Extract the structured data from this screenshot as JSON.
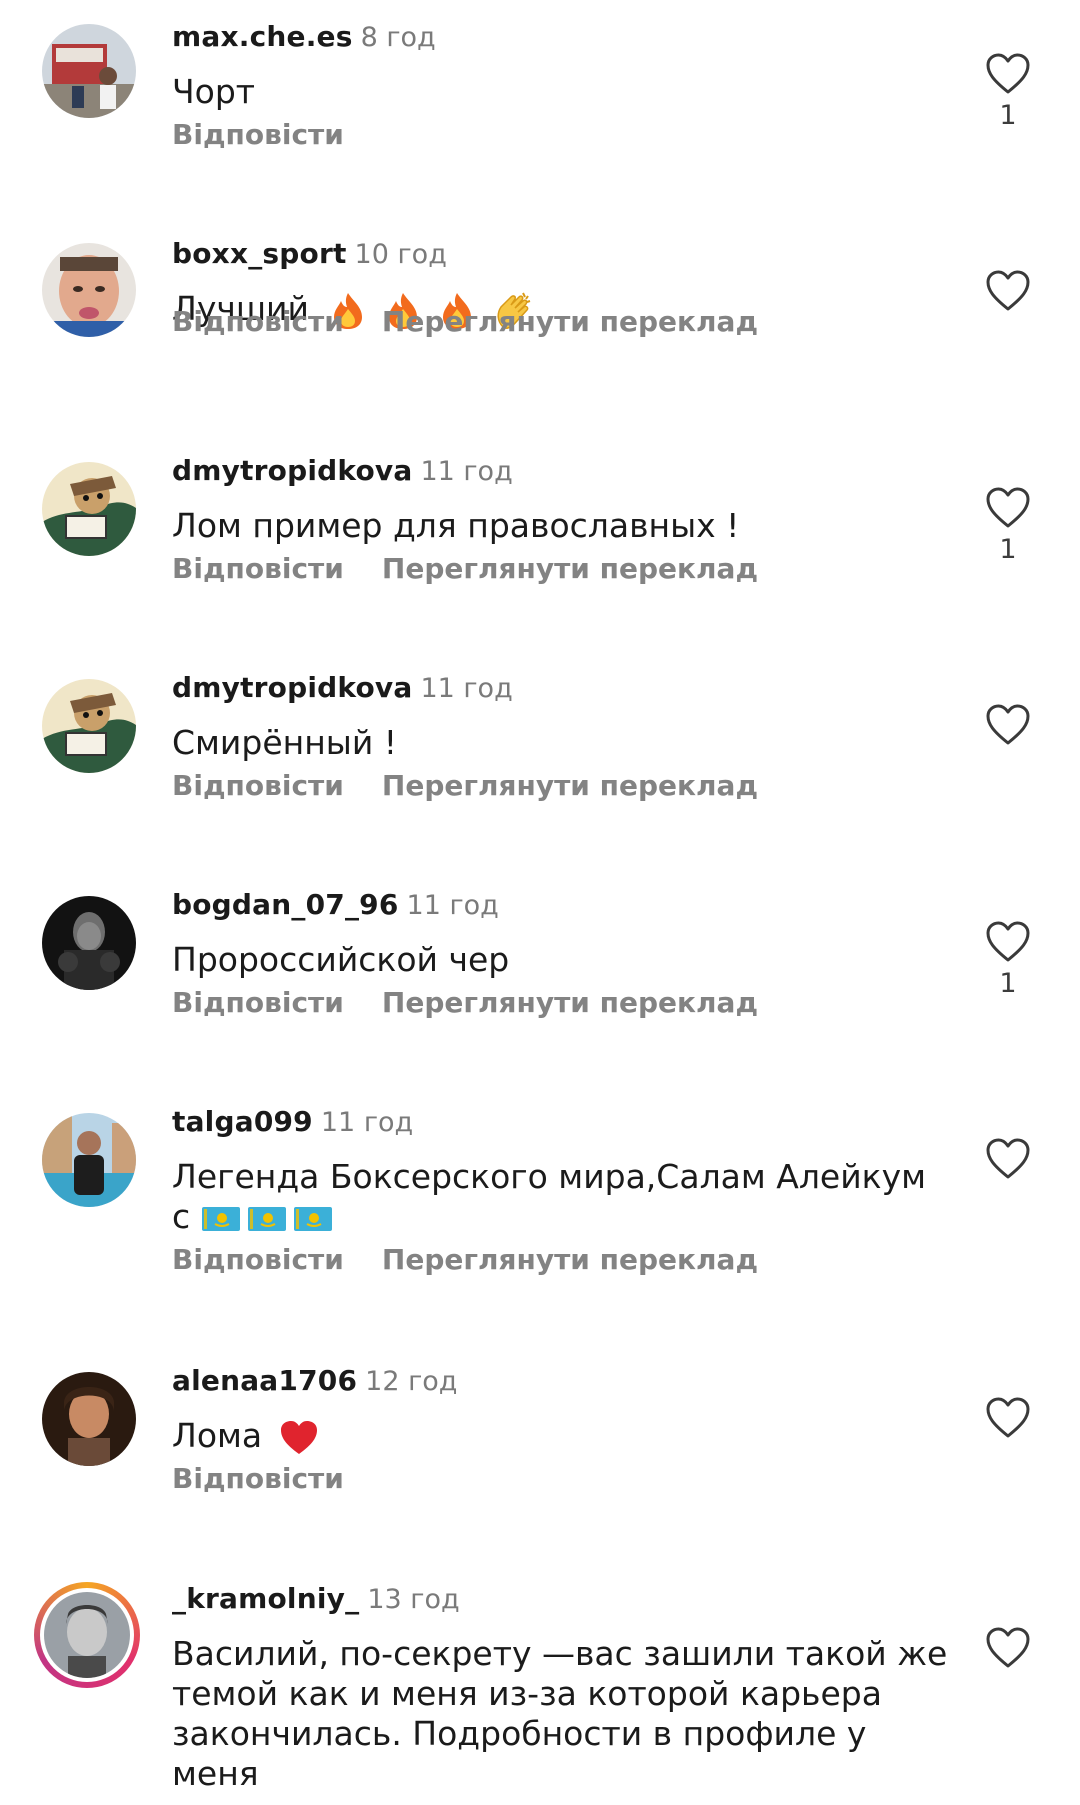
{
  "comments": [
    {
      "username": "max.che.es",
      "time": "8 год",
      "text": "Чорт",
      "likes": "1",
      "actions": {
        "reply": "Відповісти",
        "translate": ""
      },
      "avatar": "avatar-photo-street"
    },
    {
      "username": "boxx_sport",
      "time": "10 год",
      "text": "Лучший",
      "text_emojis": [
        "fire-emoji",
        "fire-emoji",
        "fire-emoji",
        "clap-emoji"
      ],
      "likes": "",
      "actions": {
        "reply": "Відповісти",
        "translate": "Переглянути переклад"
      },
      "avatar": "avatar-photo-face"
    },
    {
      "username": "dmytropidkova",
      "time": "11 год",
      "text": "Лом пример для православных !",
      "likes": "1",
      "actions": {
        "reply": "Відповісти",
        "translate": "Переглянути переклад"
      },
      "avatar": "avatar-cartoon"
    },
    {
      "username": "dmytropidkova",
      "time": "11 год",
      "text": "Смирённый !",
      "likes": "",
      "actions": {
        "reply": "Відповісти",
        "translate": "Переглянути переклад"
      },
      "avatar": "avatar-cartoon"
    },
    {
      "username": "bogdan_07_96",
      "time": "11 год",
      "text": "Пророссийской чер",
      "likes": "1",
      "actions": {
        "reply": "Відповісти",
        "translate": "Переглянути переклад"
      },
      "avatar": "avatar-boxer-dark"
    },
    {
      "username": "talga099",
      "time": "11 год",
      "text": "Легенда Боксерского мира,Салам Алейкум",
      "text_line2": "с",
      "text_emojis": [
        "kazakhstan-flag-emoji",
        "kazakhstan-flag-emoji",
        "kazakhstan-flag-emoji"
      ],
      "likes": "",
      "actions": {
        "reply": "Відповісти",
        "translate": "Переглянути переклад"
      },
      "avatar": "avatar-photo-pool"
    },
    {
      "username": "alenaa1706",
      "time": "12 год",
      "text": "Лома",
      "text_emojis": [
        "red-heart-emoji"
      ],
      "likes": "",
      "actions": {
        "reply": "Відповісти",
        "translate": ""
      },
      "avatar": "avatar-photo-woman"
    },
    {
      "username": "_kramolniy_",
      "time": "13 год",
      "text": "Василий, по-секрету —вас зашили такой же темой как и меня из-за которой карьера закончилась. Подробности в профиле у меня",
      "likes": "",
      "actions": {
        "reply": "",
        "translate": ""
      },
      "avatar": "avatar-photo-man-story-ring"
    }
  ],
  "colors": {
    "username": "#1a1a1a",
    "time": "#7a7a7a",
    "action": "#838383",
    "heart_outline": "#3a3a3a",
    "emoji_heart": "#e0242e",
    "flag_blue": "#3bb0d8",
    "flag_gold": "#f2c200"
  }
}
